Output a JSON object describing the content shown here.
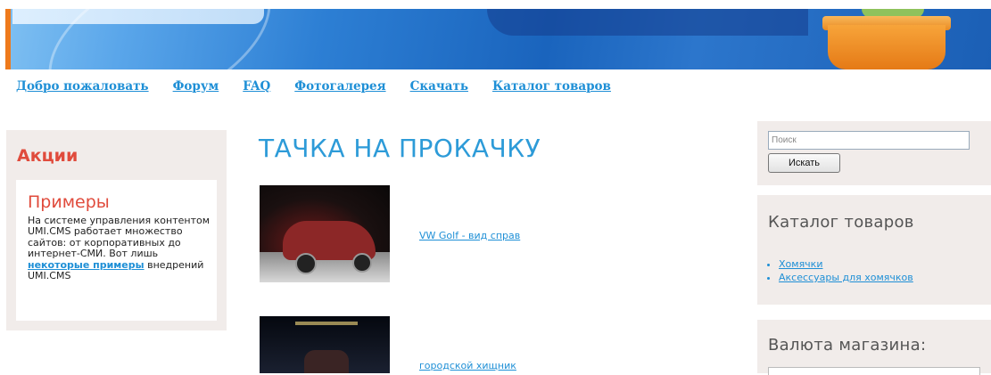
{
  "nav": {
    "items": [
      "Добро пожаловать",
      "Форум",
      "FAQ",
      "Фотогалерея",
      "Скачать",
      "Каталог товаров"
    ]
  },
  "promo": {
    "section_title": "Акции",
    "heading": "Примеры",
    "text_before": "На системе управления контентом UMI.CMS работает множество сайтов: от корпоративных до интернет-СМИ. Вот лишь ",
    "link": "некоторые примеры",
    "text_after": " внедрений UMI.CMS"
  },
  "main": {
    "title": "ТАЧКА НА ПРОКАЧКУ",
    "items": [
      {
        "label": "VW Golf - вид справ"
      },
      {
        "label": "городской хищник"
      }
    ]
  },
  "search": {
    "placeholder": "Поиск",
    "button": "Искать"
  },
  "catalog": {
    "title": "Каталог товаров",
    "items": [
      "Хомячки",
      "Аксессуары для хомячков"
    ]
  },
  "currency": {
    "title": "Валюта магазина:"
  },
  "colors": {
    "link": "#1e8fd6",
    "accent_red": "#e04b3c",
    "title_blue": "#2d9bd8",
    "panel_bg": "#f1ecea"
  }
}
